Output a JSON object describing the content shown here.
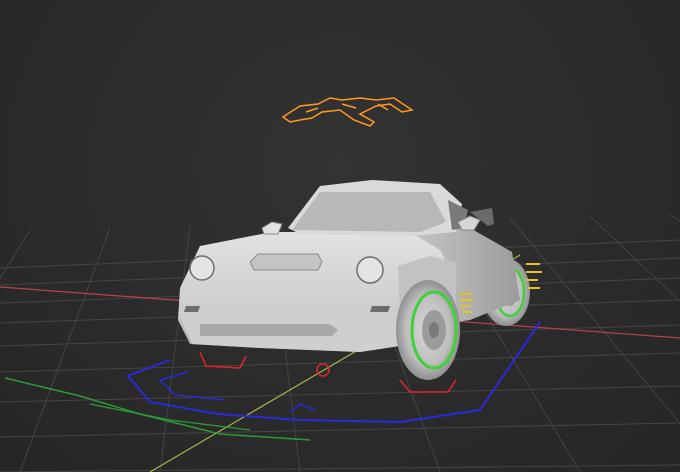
{
  "viewport": {
    "background": "#2b2b2b",
    "grid_color": "#444444",
    "x_axis_color": "#b8434f",
    "y_axis_color": "#a9b24a"
  },
  "scene": {
    "object": "car-model",
    "object_color": "#d4d4d4",
    "selection_outline_color": "#ff9a1f",
    "wheel_highlight_color": "#3fd03a",
    "rig_colors": {
      "blue": "#2a2ad8",
      "red": "#e0262a",
      "green": "#2d9a3a",
      "yellow": "#e6c21c"
    }
  }
}
